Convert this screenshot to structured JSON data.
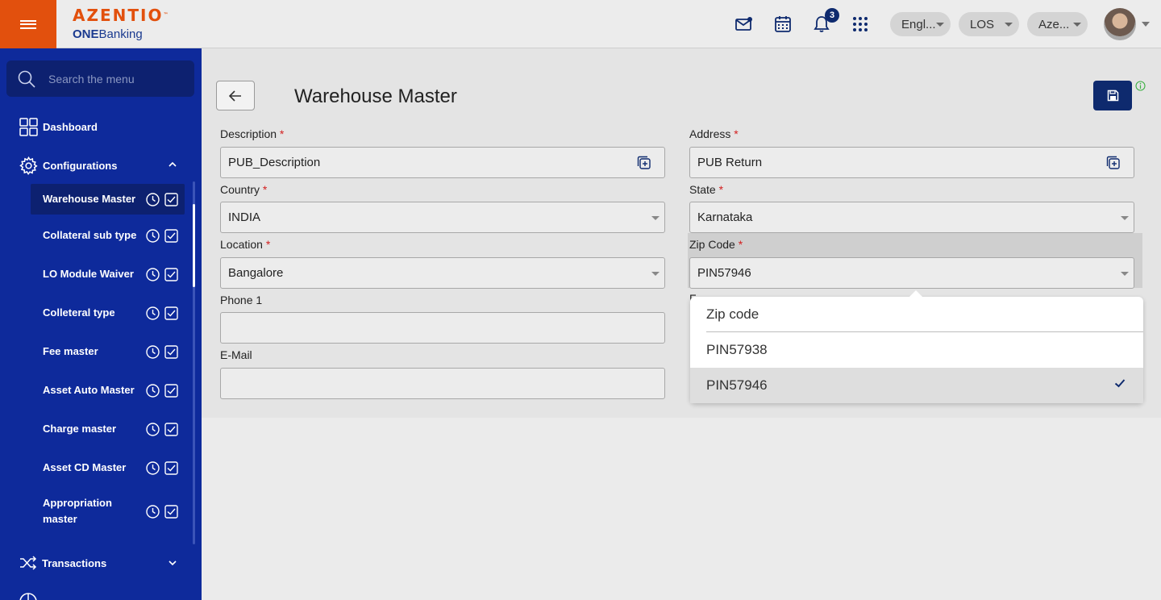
{
  "header": {
    "brand": "AZENTIO",
    "brand_tm": "™",
    "sub_bold": "ONE",
    "sub_rest": "Banking",
    "notification_count": "3",
    "language": "Engl...",
    "module": "LOS",
    "entity": "Aze...",
    "accent_color": "#e2500d",
    "icons": [
      "menu-icon",
      "mail-icon",
      "calendar-icon",
      "bell-icon",
      "apps-grid-icon"
    ]
  },
  "sidebar": {
    "search_placeholder": "Search the menu",
    "dashboard": "Dashboard",
    "configurations": "Configurations",
    "transactions": "Transactions",
    "items": [
      {
        "label": "Warehouse Master"
      },
      {
        "label": "Collateral sub type"
      },
      {
        "label": "LO Module Waiver"
      },
      {
        "label": "Colleteral type"
      },
      {
        "label": "Fee master"
      },
      {
        "label": "Asset Auto Master"
      },
      {
        "label": "Charge master"
      },
      {
        "label": "Asset CD Master"
      },
      {
        "label": "Appropriation master"
      }
    ],
    "bg_color": "#0e2a9b"
  },
  "main": {
    "title": "Warehouse Master",
    "required_mark": "*",
    "fields": {
      "description": {
        "label": "Description",
        "value": "PUB_Description"
      },
      "address": {
        "label": "Address",
        "value": "PUB Return"
      },
      "country": {
        "label": "Country",
        "value": "INDIA"
      },
      "state": {
        "label": "State",
        "value": "Karnataka"
      },
      "location": {
        "label": "Location",
        "value": "Bangalore"
      },
      "zip": {
        "label": "Zip Code",
        "value": "PIN57946"
      },
      "phone1": {
        "label": "Phone 1",
        "value": ""
      },
      "email": {
        "label": "E-Mail",
        "value": ""
      },
      "hidden_label_partial": "F"
    }
  },
  "zip_dropdown": {
    "header": "Zip code",
    "options": [
      "PIN57938",
      "PIN57946"
    ],
    "selected": "PIN57946"
  }
}
